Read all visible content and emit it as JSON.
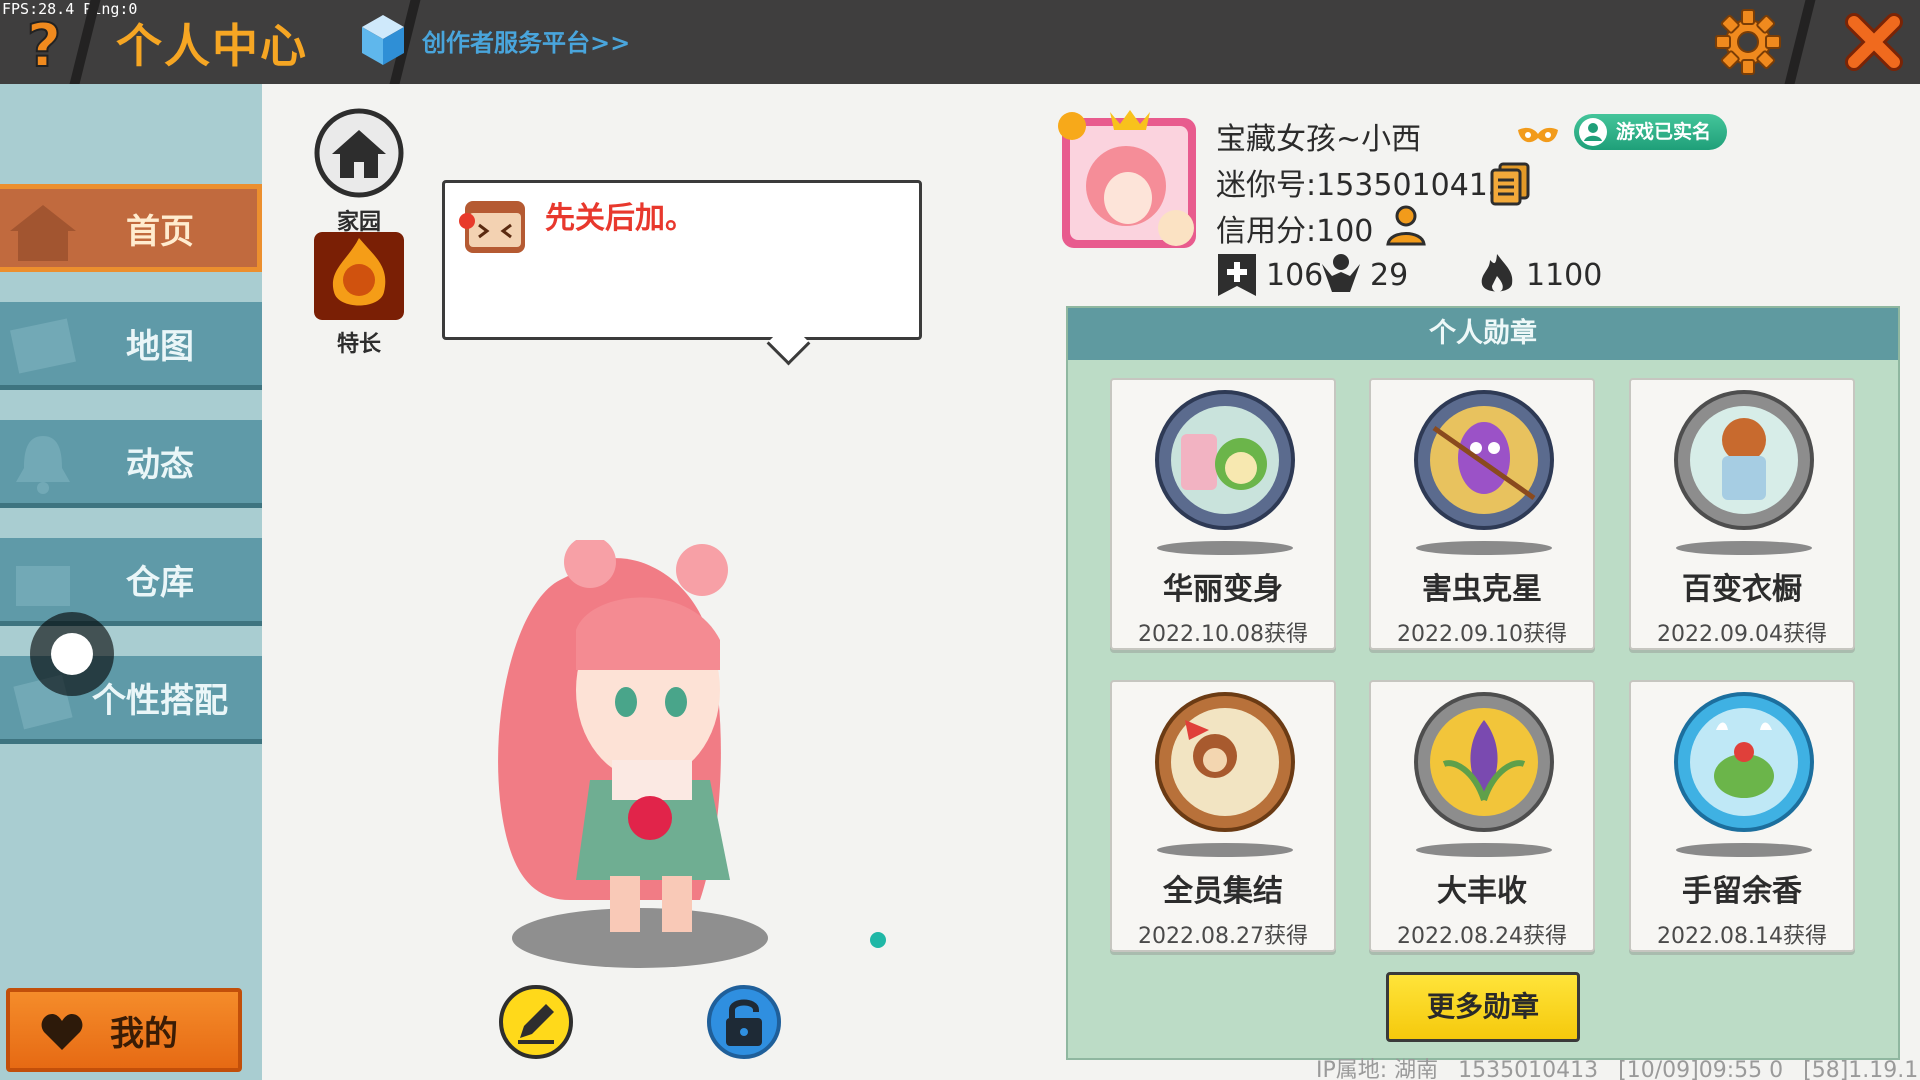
{
  "debug": {
    "fps_text": "FPS:28.4 Ping:0"
  },
  "header": {
    "title": "个人中心",
    "creator_link": "创作者服务平台>>"
  },
  "sidebar": {
    "items": [
      {
        "label": "首页",
        "icon": "house-icon",
        "active": true
      },
      {
        "label": "地图",
        "icon": "map-icon",
        "active": false
      },
      {
        "label": "动态",
        "icon": "bell-icon",
        "active": false
      },
      {
        "label": "仓库",
        "icon": "box-icon",
        "active": false
      },
      {
        "label": "个性搭配",
        "icon": "outfit-icon",
        "active": false
      }
    ],
    "mine_label": "我的"
  },
  "center": {
    "home_label": "家园",
    "talent_label": "特长",
    "bubble_text": "先关后加。"
  },
  "profile": {
    "nickname": "宝藏女孩~小西",
    "verified_label": "游戏已实名",
    "uid_text": "迷你号:1535010413",
    "credit_text": "信用分:100",
    "stats": {
      "likes": "106",
      "fans": "29",
      "heat": "1100"
    }
  },
  "medals": {
    "title": "个人勋章",
    "items": [
      {
        "name": "华丽变身",
        "date": "2022.10.08获得"
      },
      {
        "name": "害虫克星",
        "date": "2022.09.10获得"
      },
      {
        "name": "百变衣橱",
        "date": "2022.09.04获得"
      },
      {
        "name": "全员集结",
        "date": "2022.08.27获得"
      },
      {
        "name": "大丰收",
        "date": "2022.08.24获得"
      },
      {
        "name": "手留余香",
        "date": "2022.08.14获得"
      }
    ],
    "more_label": "更多勋章"
  },
  "footer": {
    "ip_text": "IP属地: 湖南",
    "uid": "1535010413",
    "time": "[10/09]09:55 0",
    "version": "[58]1.19.1"
  },
  "colors": {
    "accent_orange": "#f6a623",
    "teal": "#5f9aa8",
    "panel_green": "#bcdcc6",
    "button_yellow": "#f5c90c"
  }
}
